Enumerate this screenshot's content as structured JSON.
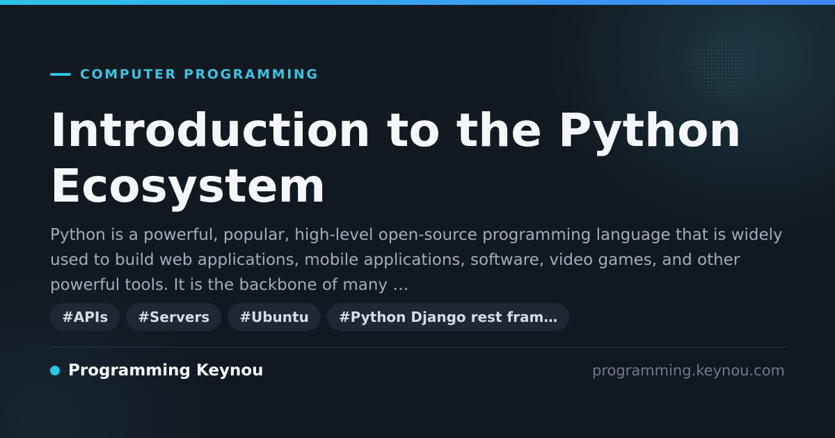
{
  "category": "COMPUTER PROGRAMMING",
  "title": "Introduction to the Python Ecosystem",
  "description": "Python is a powerful, popular, high-level open-source programming language that is widely used to build web applications, mobile applications, software, video games, and other powerful tools. It is the backbone of many …",
  "tags": [
    "#APIs",
    "#Servers",
    "#Ubuntu",
    "#Python Django rest fram…"
  ],
  "brand": {
    "name": "Programming Keynou",
    "url": "programming.keynou.com"
  },
  "colors": {
    "accent": "#2bc4e6",
    "background": "#121821",
    "title": "#f4f6f9",
    "description": "#a3acb8",
    "tag_background": "#1d2833"
  }
}
